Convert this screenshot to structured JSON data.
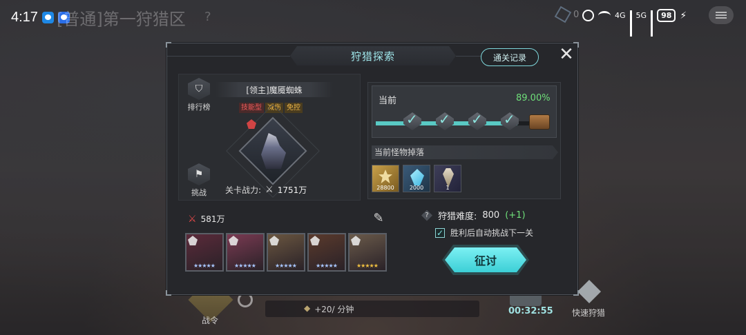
{
  "status_bar": {
    "time": "4:17",
    "signal_4g": "4G",
    "signal_5g": "5G",
    "battery": "98"
  },
  "background": {
    "title": "[普通]第一狩猎区",
    "help": "?",
    "resource_count": "0",
    "bottom": {
      "zhanling": "战令",
      "rate": "+20/ 分钟",
      "timer": "00:32:55",
      "quick_hunt": "快速狩猎"
    }
  },
  "modal": {
    "title": "狩猎探索",
    "record_button": "通关记录",
    "close": "✕",
    "boss": {
      "name": "[领主]魔魇蜘蛛",
      "tags": [
        "技能型",
        "减伤",
        "免控"
      ],
      "power_label": "关卡战力:",
      "power_value": "1751万"
    },
    "side_buttons": {
      "ranking": "排行榜",
      "challenge": "挑战"
    },
    "progress": {
      "label": "当前",
      "percent": "89.00%",
      "fraction": 0.89
    },
    "drops": {
      "header": "当前怪物掉落",
      "items": [
        {
          "name": "gold",
          "qty": "28800"
        },
        {
          "name": "crystal",
          "qty": "2000"
        },
        {
          "name": "drill",
          "qty": "1"
        }
      ]
    },
    "team": {
      "power": "581万",
      "heroes": [
        {
          "name": "hero-1",
          "stars": "★★★★★",
          "star_color": "#a9c7ff",
          "bg": "#5b2a3a"
        },
        {
          "name": "hero-2",
          "stars": "★★★★★",
          "star_color": "#a9c7ff",
          "bg": "#7a3a52"
        },
        {
          "name": "hero-3",
          "stars": "★★★★★",
          "star_color": "#a9c7ff",
          "bg": "#6a5640"
        },
        {
          "name": "hero-4",
          "stars": "★★★★★",
          "star_color": "#a9c7ff",
          "bg": "#5a3a2c"
        },
        {
          "name": "hero-5",
          "stars": "★★★★★",
          "star_color": "#f0c040",
          "bg": "#6a5a4a"
        }
      ]
    },
    "difficulty": {
      "label": "狩猎难度:",
      "value": "800",
      "increment": "(+1)"
    },
    "auto_next": {
      "checked": true,
      "label": "胜利后自动挑战下一关"
    },
    "attack_button": "征讨"
  },
  "colors": {
    "accent": "#59c9c4",
    "progress_text": "#6fe07a",
    "danger": "#e04848",
    "gold": "#f0b84a"
  }
}
